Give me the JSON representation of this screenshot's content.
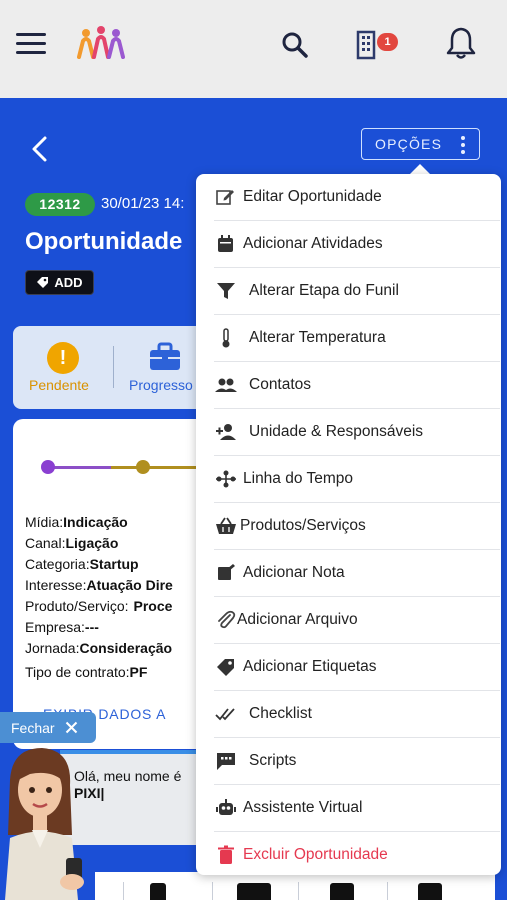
{
  "header": {
    "notification_count": "1",
    "colors": {
      "brand_blue": "#1b4fd6",
      "topbar": "#ededed"
    },
    "icons": [
      "menu-icon",
      "logo-icon",
      "search-icon",
      "building-icon",
      "bell-icon"
    ]
  },
  "opportunity": {
    "back_icon": "chevron-left-icon",
    "options_label": "OPÇÕES",
    "id": "12312",
    "date": "30/01/23 14:",
    "title": "Oportunidade",
    "add_tag_label": "ADD"
  },
  "status": {
    "items": [
      {
        "label": "Pendente",
        "icon": "exclamation-icon",
        "color": "#f0a500"
      },
      {
        "label": "Progresso",
        "icon": "briefcase-icon",
        "color": "#2d62d8"
      }
    ]
  },
  "details": {
    "fields": [
      {
        "key": "Mídia:",
        "value": "Indicação"
      },
      {
        "key": "Canal:",
        "value": "Ligação"
      },
      {
        "key": "Categoria:",
        "value": "Startup"
      },
      {
        "key": "Interesse:",
        "value": "Atuação Dire"
      },
      {
        "key": "Produto/Serviço:",
        "value": "Proce"
      },
      {
        "key": "Empresa:",
        "value": "---"
      },
      {
        "key": "Jornada:",
        "value": "Consideração"
      },
      {
        "key": "Tipo de contrato:",
        "value": "PF"
      }
    ],
    "show_more_label": "EXIBIR DADOS A"
  },
  "assistant": {
    "close_label": "Fechar",
    "greeting_line1": "Olá, meu nome é",
    "greeting_line2": "PIXI|"
  },
  "menu": {
    "items": [
      {
        "label": "Editar Oportunidade",
        "icon": "edit-icon"
      },
      {
        "label": "Adicionar Atividades",
        "icon": "calendar-icon"
      },
      {
        "label": "Alterar Etapa do Funil",
        "icon": "funnel-icon"
      },
      {
        "label": "Alterar Temperatura",
        "icon": "thermometer-icon"
      },
      {
        "label": "Contatos",
        "icon": "contacts-icon"
      },
      {
        "label": "Unidade & Responsáveis",
        "icon": "person-add-icon"
      },
      {
        "label": "Linha do Tempo",
        "icon": "timeline-icon"
      },
      {
        "label": "Produtos/Serviços",
        "icon": "basket-icon"
      },
      {
        "label": "Adicionar Nota",
        "icon": "note-icon"
      },
      {
        "label": "Adicionar Arquivo",
        "icon": "paperclip-icon"
      },
      {
        "label": "Adicionar Etiquetas",
        "icon": "tag-icon"
      },
      {
        "label": "Checklist",
        "icon": "checklist-icon"
      },
      {
        "label": "Scripts",
        "icon": "chat-icon"
      },
      {
        "label": "Assistente Virtual",
        "icon": "robot-icon"
      },
      {
        "label": "Excluir Oportunidade",
        "icon": "trash-icon",
        "color": "#e53950"
      }
    ]
  }
}
